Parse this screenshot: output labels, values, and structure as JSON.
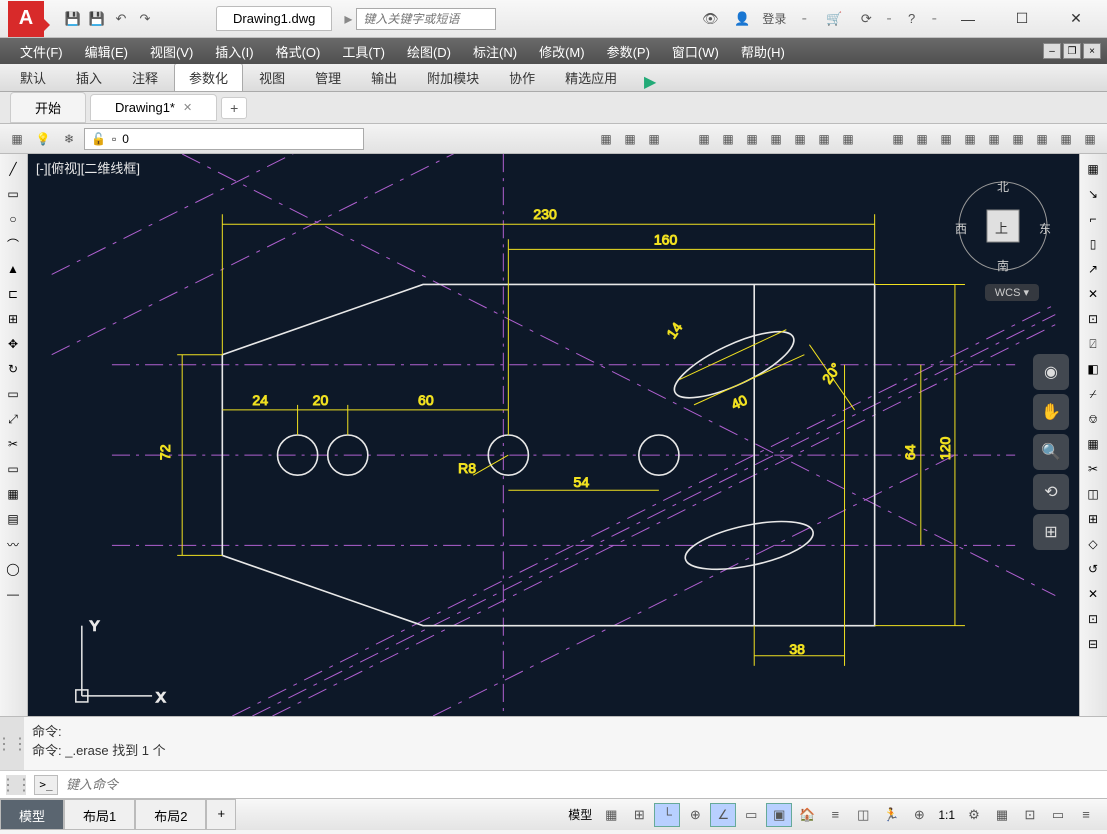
{
  "title_bar": {
    "filename": "Drawing1.dwg",
    "search_placeholder": "键入关键字或短语",
    "login": "登录"
  },
  "menu": {
    "items": [
      "文件(F)",
      "编辑(E)",
      "视图(V)",
      "插入(I)",
      "格式(O)",
      "工具(T)",
      "绘图(D)",
      "标注(N)",
      "修改(M)",
      "参数(P)",
      "窗口(W)",
      "帮助(H)"
    ]
  },
  "ribbon": {
    "tabs": [
      "默认",
      "插入",
      "注释",
      "参数化",
      "视图",
      "管理",
      "输出",
      "附加模块",
      "协作",
      "精选应用"
    ],
    "active": 3
  },
  "doc_tabs": {
    "start": "开始",
    "active": "Drawing1*"
  },
  "layer": {
    "current": "0"
  },
  "viewport": {
    "label": "[-][俯视][二维线框]"
  },
  "viewcube": {
    "n": "北",
    "s": "南",
    "e": "东",
    "w": "西",
    "top": "上",
    "wcs": "WCS ▾"
  },
  "dimensions": {
    "d230": "230",
    "d160": "160",
    "d24": "24",
    "d20": "20",
    "d60": "60",
    "d54": "54",
    "d72": "72",
    "d120": "120",
    "d64": "64",
    "d38": "38",
    "d14": "14",
    "d40": "40",
    "a20": "20°",
    "r8": "R8"
  },
  "ucs": {
    "x": "X",
    "y": "Y"
  },
  "cmd": {
    "line1": "命令:",
    "line2": "命令: _.erase 找到 1 个",
    "prompt": ">_",
    "placeholder": "键入命令"
  },
  "layout": {
    "tabs": [
      "模型",
      "布局1",
      "布局2"
    ],
    "right_label": "模型",
    "zoom": "1:1"
  }
}
